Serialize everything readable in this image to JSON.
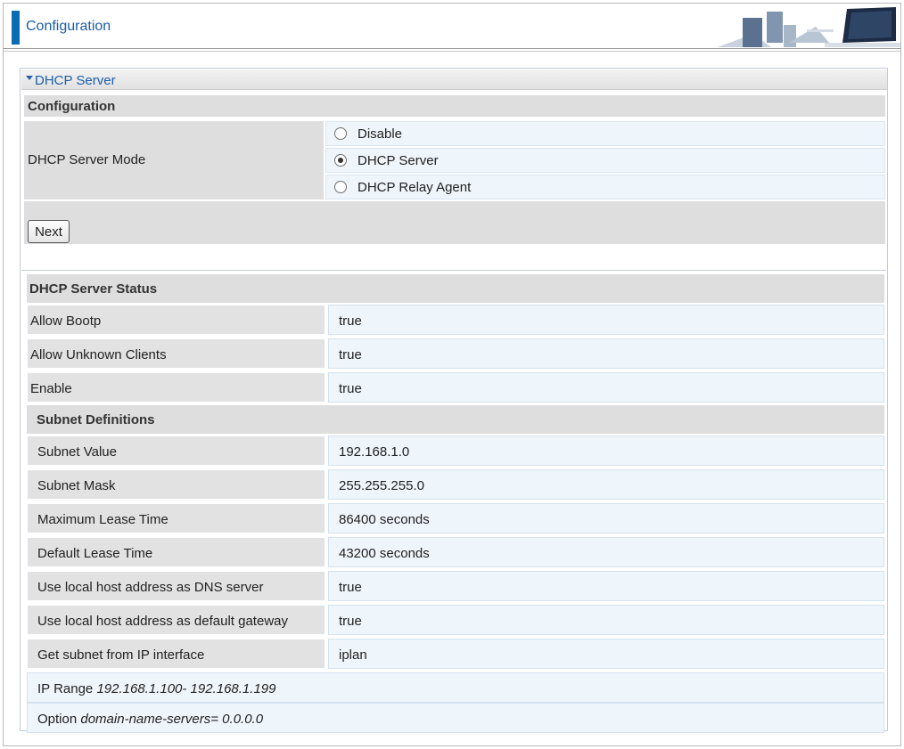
{
  "header": {
    "title": "Configuration"
  },
  "panel": {
    "title": "DHCP Server",
    "config_section": "Configuration",
    "mode_label": "DHCP Server Mode",
    "mode_options": [
      {
        "label": "Disable",
        "selected": false
      },
      {
        "label": "DHCP Server",
        "selected": true
      },
      {
        "label": "DHCP Relay Agent",
        "selected": false
      }
    ],
    "next_button": "Next"
  },
  "status": {
    "title": "DHCP Server Status",
    "rows": [
      {
        "label": "Allow Bootp",
        "value": "true"
      },
      {
        "label": "Allow Unknown Clients",
        "value": "true"
      },
      {
        "label": "Enable",
        "value": "true"
      }
    ],
    "subnet_title": "Subnet Definitions",
    "subnet_rows": [
      {
        "label": "Subnet Value",
        "value": "192.168.1.0"
      },
      {
        "label": "Subnet Mask",
        "value": "255.255.255.0"
      },
      {
        "label": "Maximum Lease Time",
        "value": "86400 seconds"
      },
      {
        "label": "Default Lease Time",
        "value": "43200 seconds"
      },
      {
        "label": "Use local host address as DNS server",
        "value": "true"
      },
      {
        "label": "Use local host address as default gateway",
        "value": "true"
      },
      {
        "label": "Get subnet from IP interface",
        "value": "iplan"
      }
    ],
    "ip_range_label": "IP Range",
    "ip_range_value": "192.168.1.100- 192.168.1.199",
    "option_label": "Option",
    "option_value": "domain-name-servers= 0.0.0.0"
  },
  "colors": {
    "accent": "#0a6cb5",
    "title_text": "#1b5ea8",
    "row_value_bg": "#eef5fb",
    "row_label_bg": "#e2e2e2"
  }
}
